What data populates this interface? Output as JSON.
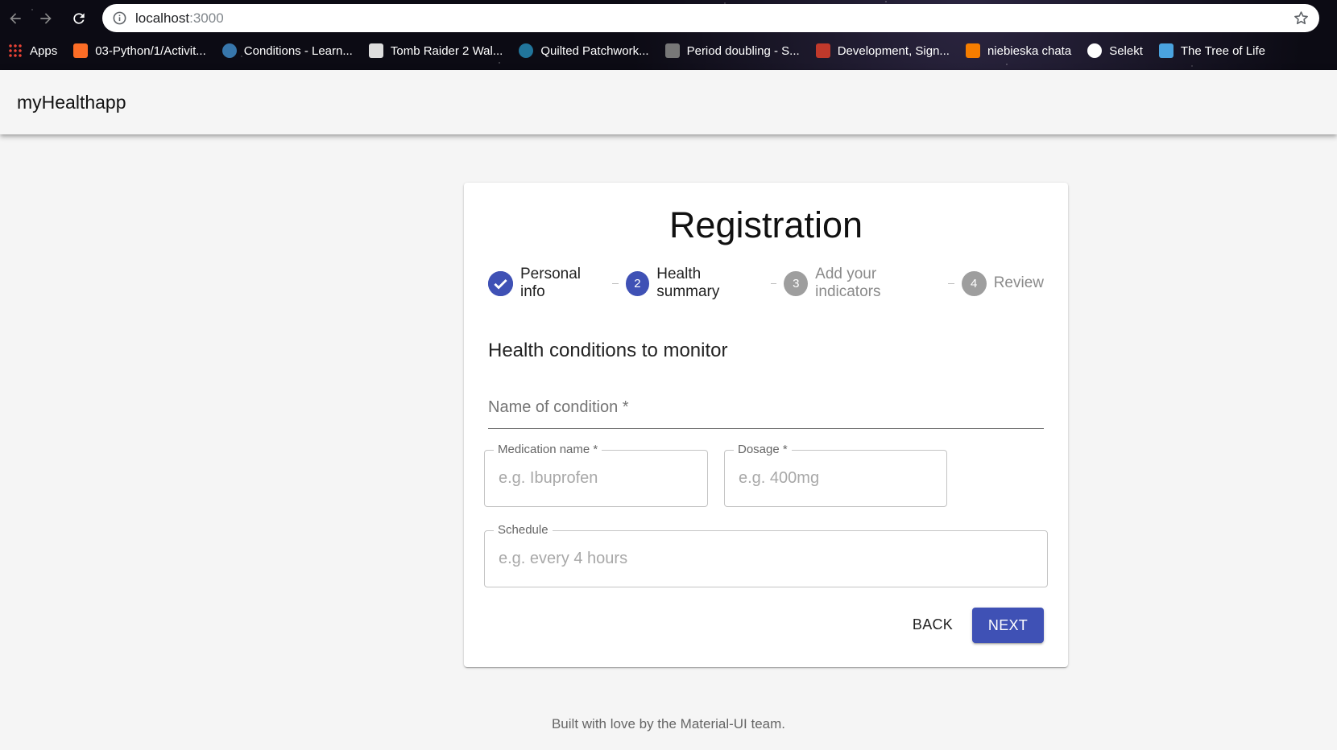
{
  "browser": {
    "url_host": "localhost",
    "url_port": ":3000",
    "bookmarks": [
      {
        "label": "Apps",
        "icon": "apps-grid-icon",
        "color": "#ea4335"
      },
      {
        "label": "03-Python/1/Activit...",
        "icon": "gitlab-icon",
        "color": "#fc6d26"
      },
      {
        "label": "Conditions - Learn...",
        "icon": "python-icon",
        "color": "#3776ab"
      },
      {
        "label": "Tomb Raider 2 Wal...",
        "icon": "tomb-raider-icon",
        "color": "#dddddd"
      },
      {
        "label": "Quilted Patchwork...",
        "icon": "wordpress-icon",
        "color": "#21759b"
      },
      {
        "label": "Period doubling - S...",
        "icon": "fractal-icon",
        "color": "#777777"
      },
      {
        "label": "Development, Sign...",
        "icon": "pattern-icon",
        "color": "#c0392b"
      },
      {
        "label": "niebieska chata",
        "icon": "blogger-icon",
        "color": "#f57d00"
      },
      {
        "label": "Selekt",
        "icon": "globe-icon",
        "color": "#ffffff"
      },
      {
        "label": "The Tree of Life",
        "icon": "tree-icon",
        "color": "#4aa3df"
      }
    ]
  },
  "appbar": {
    "title": "myHealthapp"
  },
  "card": {
    "title": "Registration",
    "steps": [
      {
        "label": "Personal info",
        "number": "",
        "state": "completed"
      },
      {
        "label": "Health summary",
        "number": "2",
        "state": "active"
      },
      {
        "label": "Add your indicators",
        "number": "3",
        "state": "pending"
      },
      {
        "label": "Review",
        "number": "4",
        "state": "pending"
      }
    ],
    "section_title": "Health conditions to monitor",
    "fields": {
      "condition": {
        "label": "Name of condition *",
        "value": ""
      },
      "medication": {
        "label": "Medication name *",
        "placeholder": "e.g. Ibuprofen"
      },
      "dosage": {
        "label": "Dosage *",
        "placeholder": "e.g. 400mg"
      },
      "schedule": {
        "label": "Schedule",
        "placeholder": "e.g. every 4 hours"
      }
    },
    "buttons": {
      "back": "BACK",
      "next": "NEXT"
    }
  },
  "footer": {
    "text": "Built with love by the Material-UI team."
  },
  "colors": {
    "primary": "#3f51b5",
    "inactive_step": "#9e9e9e"
  }
}
